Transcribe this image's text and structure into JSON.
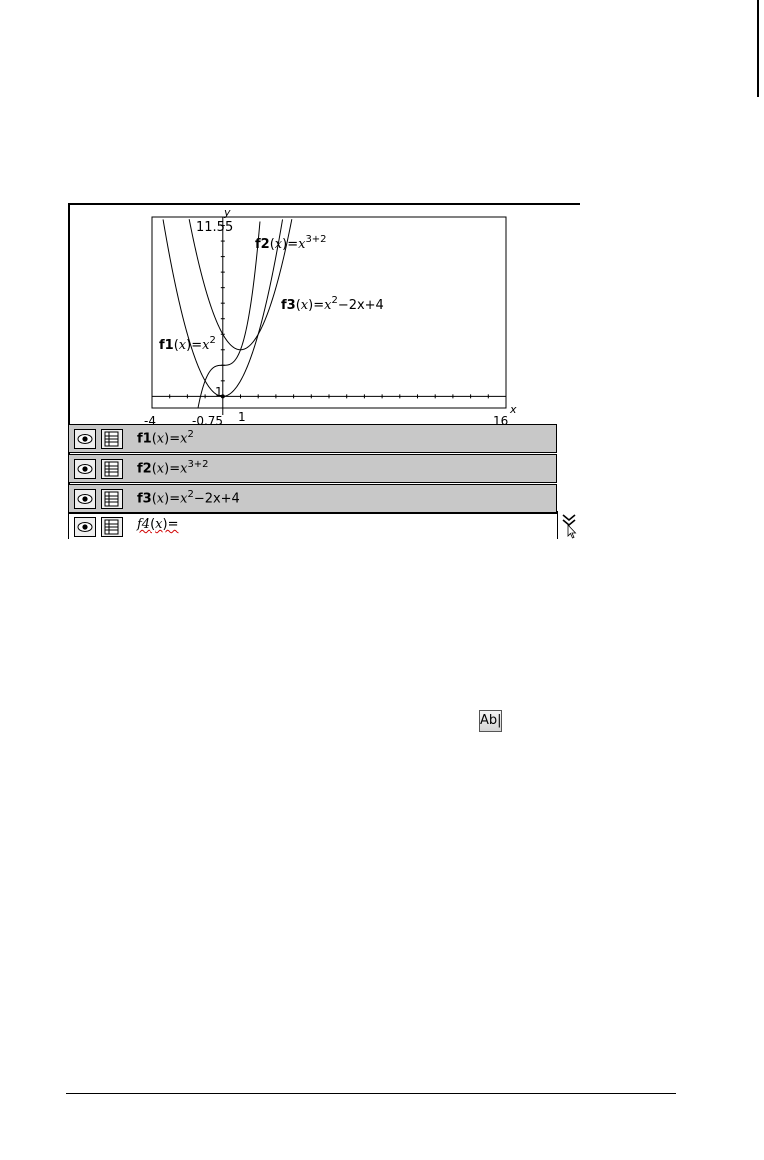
{
  "graph": {
    "window": {
      "xmin": -4,
      "xmax": 16,
      "ymin": -0.75,
      "ymax": 11.55
    },
    "tick_labels": {
      "ymax": "11.55",
      "y_one": "1",
      "xmin": "-4",
      "ymin": "-0.75",
      "x_one": "1",
      "xmax": "16"
    },
    "axis_names": {
      "x": "x",
      "y": "y"
    },
    "plot_labels": [
      {
        "name": "f2",
        "arg": "x",
        "rhs": "x",
        "exp": "3+2"
      },
      {
        "name": "f3",
        "arg": "x",
        "rhs": "x",
        "exp": "2",
        "tail": "−2x+4"
      },
      {
        "name": "f1",
        "arg": "x",
        "rhs": "x",
        "exp": "2"
      }
    ]
  },
  "entry_line": {
    "rows": [
      {
        "name": "f1",
        "open": "(",
        "arg": "x",
        "close": ")=",
        "base": "x",
        "exp": "2",
        "tail": ""
      },
      {
        "name": "f2",
        "open": "(",
        "arg": "x",
        "close": ")=",
        "base": "x",
        "exp": "3+2",
        "tail": ""
      },
      {
        "name": "f3",
        "open": "(",
        "arg": "x",
        "close": ")=",
        "base": "x",
        "exp": "2",
        "tail": "−2x+4"
      }
    ],
    "input_row": {
      "name": "f4",
      "open": "(",
      "arg": "x",
      "close": ")="
    }
  },
  "text_tool_button": {
    "label": "Ab|",
    "icon": "text-tool-icon"
  },
  "icons": {
    "eye": "eye-icon",
    "table": "table-icon",
    "collapse": "collapse-chevron-icon"
  },
  "colors": {
    "row_bg": "#c8c8c8",
    "error_underline": "#d00000"
  }
}
